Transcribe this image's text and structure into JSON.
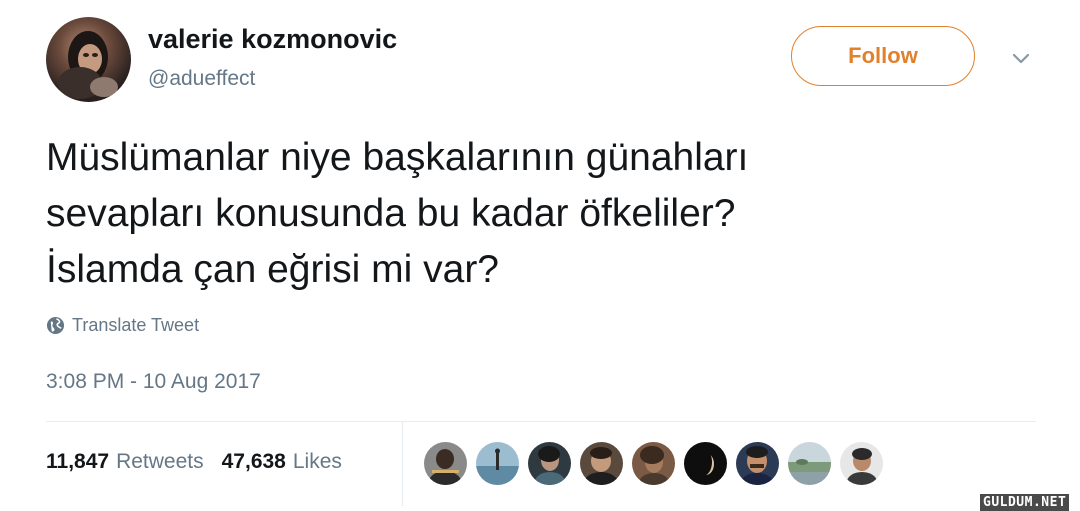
{
  "tweet": {
    "author": {
      "display_name": "valerie kozmonovic",
      "username": "@adueffect",
      "avatar_icon": "profile-photo"
    },
    "follow_label": "Follow",
    "caret_icon": "chevron-down-icon",
    "text_lines": [
      "Müslümanlar niye başkalarının günahları",
      "sevapları konusunda bu kadar öfkeliler?",
      "İslamda çan eğrisi mi var?"
    ],
    "translate_label": "Translate Tweet",
    "translate_icon": "globe-icon",
    "timestamp": "3:08 PM - 10 Aug 2017",
    "stats": {
      "retweets_count": "11,847",
      "retweets_label": "Retweets",
      "likes_count": "47,638",
      "likes_label": "Likes"
    },
    "likers_count_shown": 9
  },
  "watermark": "GULDUM.NET",
  "colors": {
    "accent": "#e0812e",
    "text": "#14171a",
    "secondary_text": "#657786",
    "divider": "#e6ecf0"
  }
}
